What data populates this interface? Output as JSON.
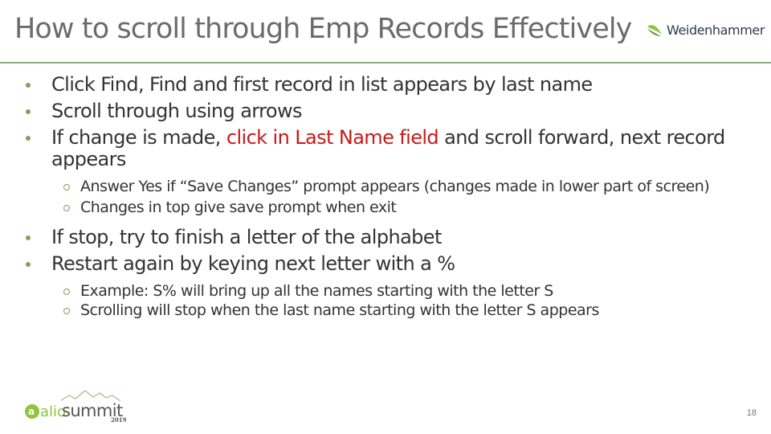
{
  "slide": {
    "title": "How to scroll through Emp Records Effectively",
    "brand": {
      "name": "Weidenhammer",
      "icon": "leaf-swoosh-icon",
      "accent_color": "#7ca35a"
    },
    "bullets": [
      {
        "text": "Click Find, Find and first record in list appears by last name"
      },
      {
        "text": "Scroll through using arrows"
      },
      {
        "text_before": "If change is made, ",
        "highlight": "click in Last Name field",
        "text_after": " and scroll forward, next record appears",
        "highlight_color": "#c81919",
        "sub_bullets": [
          "Answer Yes if “Save Changes” prompt appears (changes made in lower part of screen)",
          "Changes in top give save prompt when exit"
        ]
      },
      {
        "text": "If stop, try to finish a letter of the alphabet"
      },
      {
        "text": "Restart again by keying next letter with a %",
        "sub_bullets": [
          "Example:  S% will bring up all the names starting with the letter S",
          "Scrolling will stop when the last name starting with the letter S appears"
        ]
      }
    ],
    "footer": {
      "event_logo": {
        "prefix": "alio",
        "name": "summit",
        "year": "2019"
      },
      "page_number": "18"
    }
  }
}
